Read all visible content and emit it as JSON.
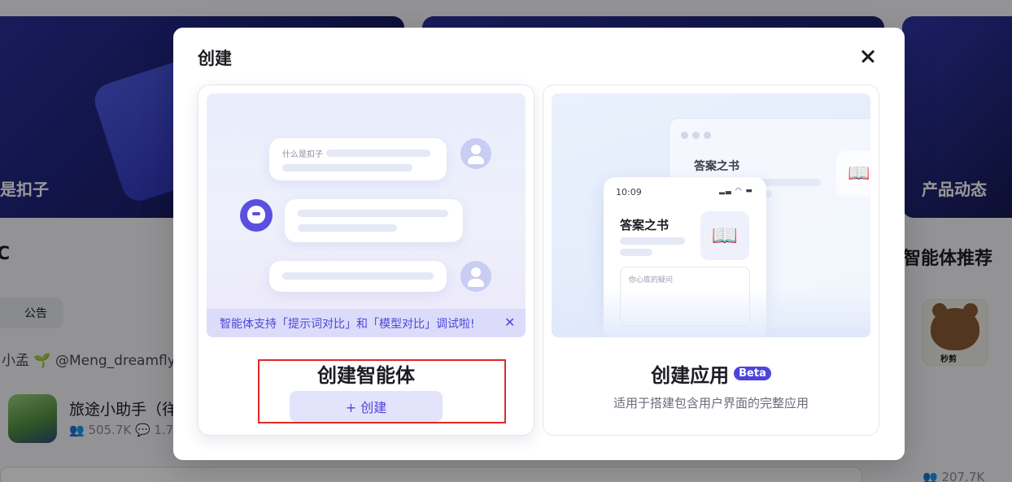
{
  "background": {
    "banner_left_label": "是扣子",
    "banner_right_label": "产品动态",
    "section_left_title": "C",
    "section_right_title": "智能体推荐",
    "tab_label": "公告",
    "author_line": "小孟 🌱 @Meng_dreamfly",
    "item_title": "旅途小助手（徉",
    "item_stats": "👥 505.7K   💬 1.7",
    "right_badge": "秒剪",
    "bottom_right_stats": "👥 207.7K"
  },
  "modal": {
    "title": "创建",
    "agent": {
      "chat_question": "什么是扣子",
      "notice": "智能体支持「提示词对比」和「模型对比」调试啦!",
      "notice_close": "✕",
      "title": "创建智能体",
      "button_label": "+ 创建"
    },
    "app": {
      "title": "创建应用",
      "badge": "Beta",
      "description": "适用于搭建包含用户界面的完整应用",
      "window_title": "答案之书",
      "phone_time": "10:09",
      "phone_title": "答案之书",
      "phone_placeholder": "你心底的疑问"
    }
  },
  "colors": {
    "accent": "#4c45d9",
    "highlight_box": "#e02929"
  }
}
